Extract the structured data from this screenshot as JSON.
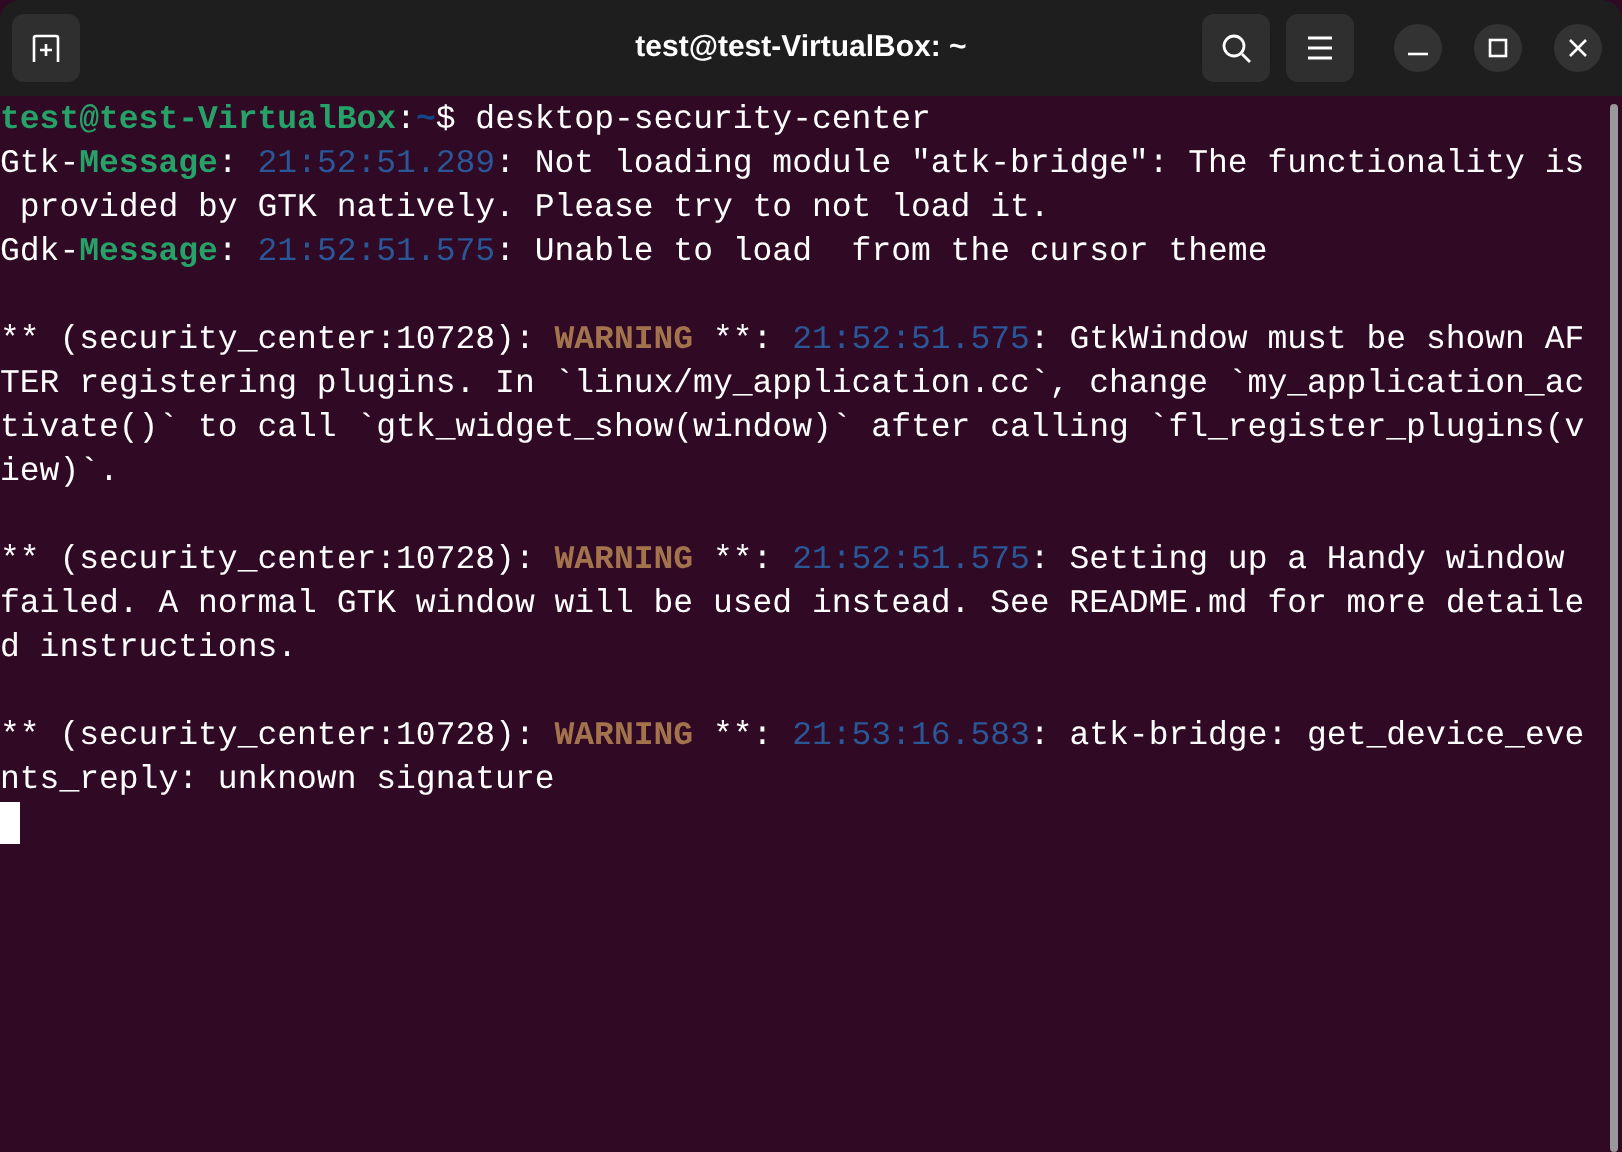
{
  "window": {
    "title": "test@test-VirtualBox: ~"
  },
  "terminal": {
    "lines": [
      {
        "kind": "text",
        "segments": [
          {
            "kind": "prompt_user",
            "text": "test@test-VirtualBox"
          },
          {
            "kind": "plain",
            "text": ":"
          },
          {
            "kind": "prompt_path",
            "text": "~"
          },
          {
            "kind": "plain",
            "text": "$ desktop-security-center"
          }
        ]
      },
      {
        "kind": "text",
        "segments": [
          {
            "kind": "plain",
            "text": "Gtk-"
          },
          {
            "kind": "label",
            "text": "Message"
          },
          {
            "kind": "plain",
            "text": ": "
          },
          {
            "kind": "time",
            "text": "21:52:51.289"
          },
          {
            "kind": "plain",
            "text": ": Not loading module \"atk-bridge\": The functionality is"
          }
        ]
      },
      {
        "kind": "text",
        "segments": [
          {
            "kind": "plain",
            "text": " provided by GTK natively. Please try to not load it."
          }
        ]
      },
      {
        "kind": "text",
        "segments": [
          {
            "kind": "plain",
            "text": "Gdk-"
          },
          {
            "kind": "label",
            "text": "Message"
          },
          {
            "kind": "plain",
            "text": ": "
          },
          {
            "kind": "time",
            "text": "21:52:51.575"
          },
          {
            "kind": "plain",
            "text": ": Unable to load  from the cursor theme"
          }
        ]
      },
      {
        "kind": "blank"
      },
      {
        "kind": "text",
        "segments": [
          {
            "kind": "plain",
            "text": "** (security_center:10728): "
          },
          {
            "kind": "warning",
            "text": "WARNING"
          },
          {
            "kind": "plain",
            "text": " **: "
          },
          {
            "kind": "time",
            "text": "21:52:51.575"
          },
          {
            "kind": "plain",
            "text": ": GtkWindow must be shown AF"
          }
        ]
      },
      {
        "kind": "text",
        "segments": [
          {
            "kind": "plain",
            "text": "TER registering plugins. In `linux/my_application.cc`, change `my_application_ac"
          }
        ]
      },
      {
        "kind": "text",
        "segments": [
          {
            "kind": "plain",
            "text": "tivate()` to call `gtk_widget_show(window)` after calling `fl_register_plugins(v"
          }
        ]
      },
      {
        "kind": "text",
        "segments": [
          {
            "kind": "plain",
            "text": "iew)`."
          }
        ]
      },
      {
        "kind": "blank"
      },
      {
        "kind": "text",
        "segments": [
          {
            "kind": "plain",
            "text": "** (security_center:10728): "
          },
          {
            "kind": "warning",
            "text": "WARNING"
          },
          {
            "kind": "plain",
            "text": " **: "
          },
          {
            "kind": "time",
            "text": "21:52:51.575"
          },
          {
            "kind": "plain",
            "text": ": Setting up a Handy window"
          }
        ]
      },
      {
        "kind": "text",
        "segments": [
          {
            "kind": "plain",
            "text": "failed. A normal GTK window will be used instead. See README.md for more detaile"
          }
        ]
      },
      {
        "kind": "text",
        "segments": [
          {
            "kind": "plain",
            "text": "d instructions."
          }
        ]
      },
      {
        "kind": "blank"
      },
      {
        "kind": "text",
        "segments": [
          {
            "kind": "plain",
            "text": "** (security_center:10728): "
          },
          {
            "kind": "warning",
            "text": "WARNING"
          },
          {
            "kind": "plain",
            "text": " **: "
          },
          {
            "kind": "time",
            "text": "21:53:16.583"
          },
          {
            "kind": "plain",
            "text": ": atk-bridge: get_device_eve"
          }
        ]
      },
      {
        "kind": "text",
        "segments": [
          {
            "kind": "plain",
            "text": "nts_reply: unknown signature"
          }
        ]
      }
    ]
  }
}
